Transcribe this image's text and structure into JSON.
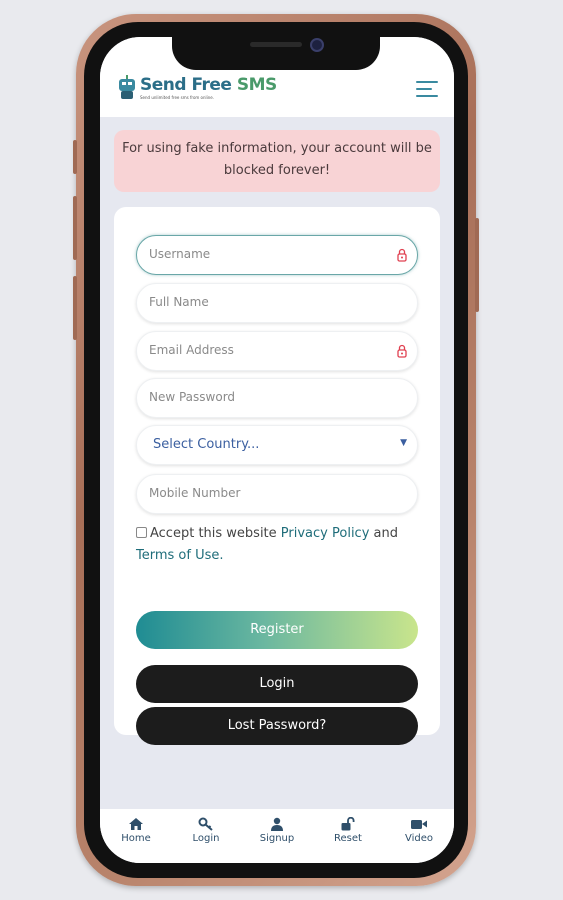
{
  "header": {
    "brand_part1": "Send Free ",
    "brand_part2": "SMS",
    "tagline": "Send unlimited free sms from online."
  },
  "alert": {
    "message": "For using fake information, your account will be blocked forever!"
  },
  "form": {
    "username_placeholder": "Username",
    "fullname_placeholder": "Full Name",
    "email_placeholder": "Email Address",
    "password_placeholder": "New Password",
    "country_select": "Select Country...",
    "mobile_placeholder": "Mobile Number",
    "terms_prefix": "Accept this website ",
    "privacy_link": "Privacy Policy",
    "terms_and": " and",
    "terms_link": "Terms of Use.",
    "register_label": "Register",
    "login_label": "Login",
    "lost_password_label": "Lost Password?"
  },
  "bottom_nav": {
    "items": [
      {
        "label": "Home",
        "icon": "home-icon"
      },
      {
        "label": "Login",
        "icon": "key-icon"
      },
      {
        "label": "Signup",
        "icon": "user-icon"
      },
      {
        "label": "Reset",
        "icon": "unlock-icon"
      },
      {
        "label": "Video",
        "icon": "video-icon"
      }
    ]
  },
  "colors": {
    "accent": "#1f8c93",
    "alert_bg": "#f8d3d5",
    "dark_button": "#1c1c1c",
    "phone_frame": "#b8836b"
  }
}
